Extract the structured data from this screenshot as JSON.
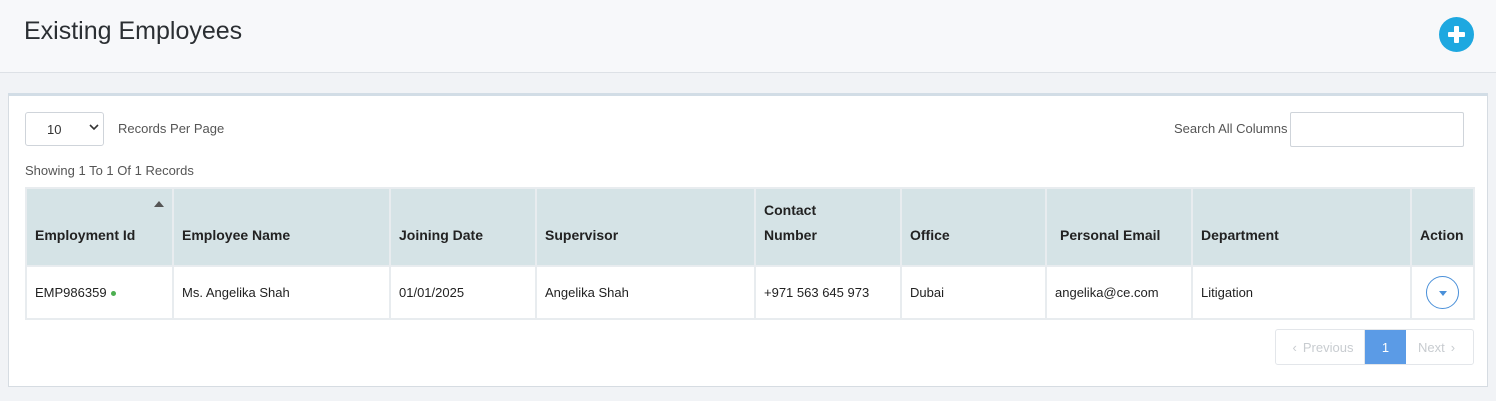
{
  "header": {
    "title": "Existing Employees",
    "add_icon": "plus-circle-icon",
    "accent_color": "#1ea8e0"
  },
  "controls": {
    "per_page_value": "10",
    "per_page_label": "Records Per Page",
    "search_label": "Search All Columns",
    "search_value": "",
    "showing_text": "Showing 1 To 1 Of 1 Records"
  },
  "table": {
    "columns": {
      "employment_id": "Employment Id",
      "employee_name": "Employee Name",
      "joining_date": "Joining Date",
      "supervisor": "Supervisor",
      "contact_line1": "Contact",
      "contact_line2": "Number",
      "office": "Office",
      "personal_email": "Personal Email",
      "department": "Department",
      "action": "Action"
    },
    "sort_column": "Employment Id",
    "sort_direction": "ascending",
    "rows": [
      {
        "employment_id": "EMP986359",
        "status_color": "#4caf50",
        "employee_name": "Ms. Angelika Shah",
        "joining_date": "01/01/2025",
        "supervisor": "Angelika Shah",
        "contact_number": "+971 563 645 973",
        "office": "Dubai",
        "personal_email": "angelika@ce.com",
        "department": "Litigation"
      }
    ]
  },
  "pagination": {
    "previous_label": "Previous",
    "current_page": "1",
    "next_label": "Next",
    "active_color": "#5b9be6"
  }
}
